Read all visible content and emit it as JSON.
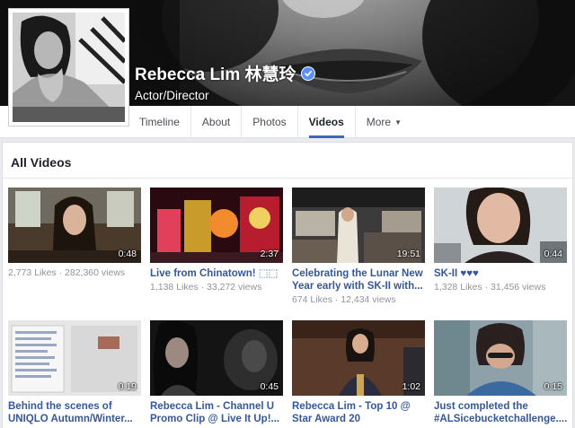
{
  "profile": {
    "name": "Rebecca Lim 林慧玲",
    "category": "Actor/Director"
  },
  "nav": {
    "tabs": [
      {
        "label": "Timeline"
      },
      {
        "label": "About"
      },
      {
        "label": "Photos"
      },
      {
        "label": "Videos"
      },
      {
        "label": "More"
      }
    ],
    "active": "Videos"
  },
  "section": {
    "title": "All Videos"
  },
  "videos": [
    {
      "title": "",
      "meta": "2,773 Likes · 282,360 views",
      "duration": "0:48"
    },
    {
      "title": "Live from Chinatown! ⬚⬚",
      "meta": "1,138 Likes · 33,272 views",
      "duration": "2:37"
    },
    {
      "title": "Celebrating the Lunar New Year early with SK-II with...",
      "meta": "674 Likes · 12,434 views",
      "duration": "19:51"
    },
    {
      "title": "SK-II ♥♥♥",
      "meta": "1,328 Likes · 31,456 views",
      "duration": "0:44"
    },
    {
      "title": "Behind the scenes of UNIQLO Autumn/Winter...",
      "meta": "",
      "duration": "0:19"
    },
    {
      "title": "Rebecca Lim - Channel U Promo Clip @ Live It Up!...",
      "meta": "",
      "duration": "0:45"
    },
    {
      "title": "Rebecca Lim - Top 10 @ Star Award 20",
      "meta": "",
      "duration": "1:02"
    },
    {
      "title": "Just completed the #ALSicebucketchallenge....",
      "meta": "",
      "duration": "0:15"
    }
  ],
  "colors": {
    "link": "#365899",
    "accent": "#4267b2",
    "verified": "#5890ff",
    "muted": "#90949c"
  }
}
